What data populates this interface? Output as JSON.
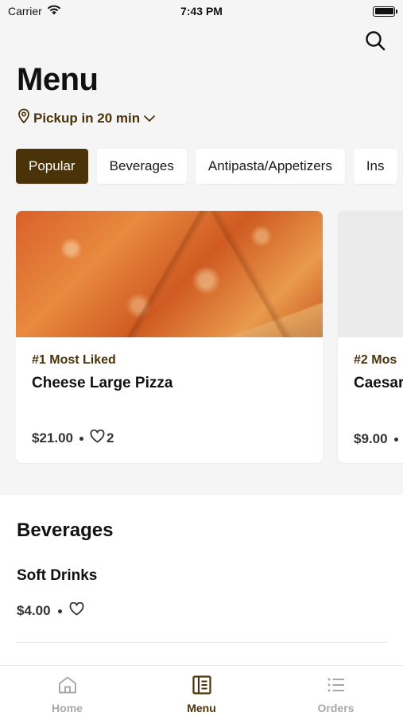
{
  "status_bar": {
    "carrier": "Carrier",
    "time": "7:43 PM"
  },
  "header": {
    "title": "Menu",
    "pickup_label": "Pickup in 20 min"
  },
  "categories": [
    {
      "label": "Popular",
      "active": true
    },
    {
      "label": "Beverages",
      "active": false
    },
    {
      "label": "Antipasta/Appetizers",
      "active": false
    },
    {
      "label": "Ins",
      "active": false
    }
  ],
  "popular": [
    {
      "rank": "#1 Most Liked",
      "name": "Cheese Large Pizza",
      "price": "$21.00",
      "likes": "2"
    },
    {
      "rank": "#2 Mos",
      "name": "Caesar",
      "price": "$9.00",
      "likes": ""
    }
  ],
  "beverages": {
    "title": "Beverages",
    "items": [
      {
        "name": "Soft Drinks",
        "price": "$4.00"
      }
    ]
  },
  "tabbar": {
    "items": [
      {
        "label": "Home",
        "icon": "home-icon",
        "active": false
      },
      {
        "label": "Menu",
        "icon": "menu-book-icon",
        "active": true
      },
      {
        "label": "Orders",
        "icon": "list-icon",
        "active": false
      }
    ]
  },
  "colors": {
    "accent": "#4a3308",
    "background": "#f5f5f5",
    "inactive_tab": "#a8a8a8"
  }
}
